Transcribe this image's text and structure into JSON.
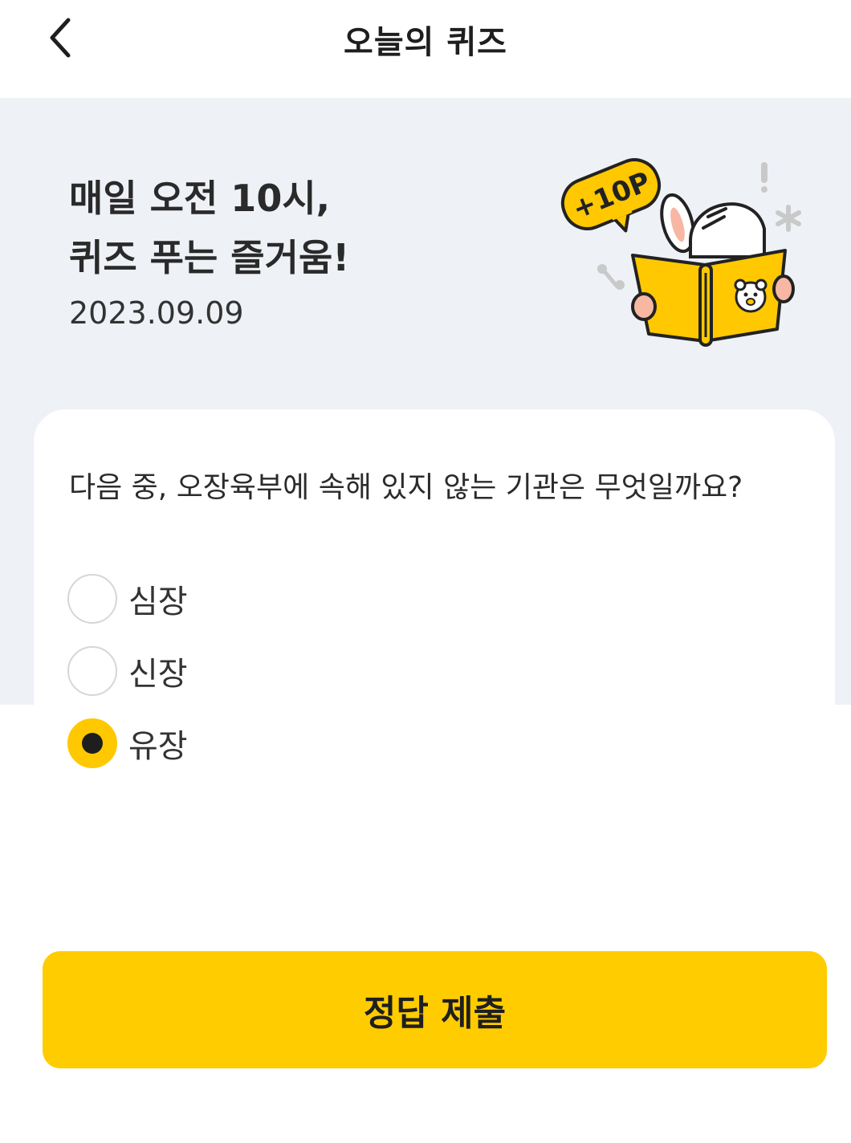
{
  "header": {
    "title": "오늘의 퀴즈",
    "back_icon": "chevron-left-icon"
  },
  "banner": {
    "title_line1": "매일 오전 10시,",
    "title_line2": "퀴즈 푸는 즐거움!",
    "date": "2023.09.09",
    "badge": "+10P"
  },
  "quiz": {
    "question": "다음 중, 오장육부에 속해 있지 않는 기관은 무엇일까요?",
    "options": [
      {
        "label": "심장",
        "selected": false
      },
      {
        "label": "신장",
        "selected": false
      },
      {
        "label": "유장",
        "selected": true
      }
    ]
  },
  "submit": {
    "label": "정답 제출"
  },
  "colors": {
    "accent": "#ffcc00",
    "banner_bg": "#eef1f6"
  }
}
